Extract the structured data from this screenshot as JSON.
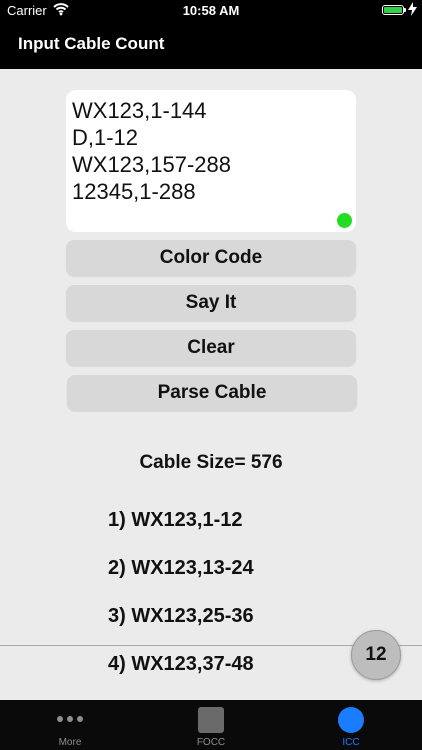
{
  "status_bar": {
    "carrier": "Carrier",
    "time": "10:58 AM",
    "battery_color": "#33d14b"
  },
  "nav": {
    "title": "Input Cable Count"
  },
  "input": {
    "lines": [
      "WX123,1-144",
      "D,1-12",
      "WX123,157-288",
      "12345,1-288"
    ],
    "status_color": "#22dd22"
  },
  "buttons": {
    "color_code": "Color Code",
    "say_it": "Say It",
    "clear": "Clear",
    "parse_cable": "Parse Cable"
  },
  "results": {
    "cable_size": "Cable Size= 576",
    "items": [
      "1) WX123,1-12",
      "2) WX123,13-24",
      "3) WX123,25-36",
      "4) WX123,37-48"
    ]
  },
  "fab": {
    "label": "12"
  },
  "tabs": [
    {
      "label": "More",
      "icon": "more-icon"
    },
    {
      "label": "FOCC",
      "icon": "folder-icon"
    },
    {
      "label": "ICC",
      "icon": "circle-icon",
      "active": true
    }
  ],
  "colors": {
    "accent": "#1a7cff",
    "background": "#ebebeb",
    "button": "#d8d8d8"
  }
}
